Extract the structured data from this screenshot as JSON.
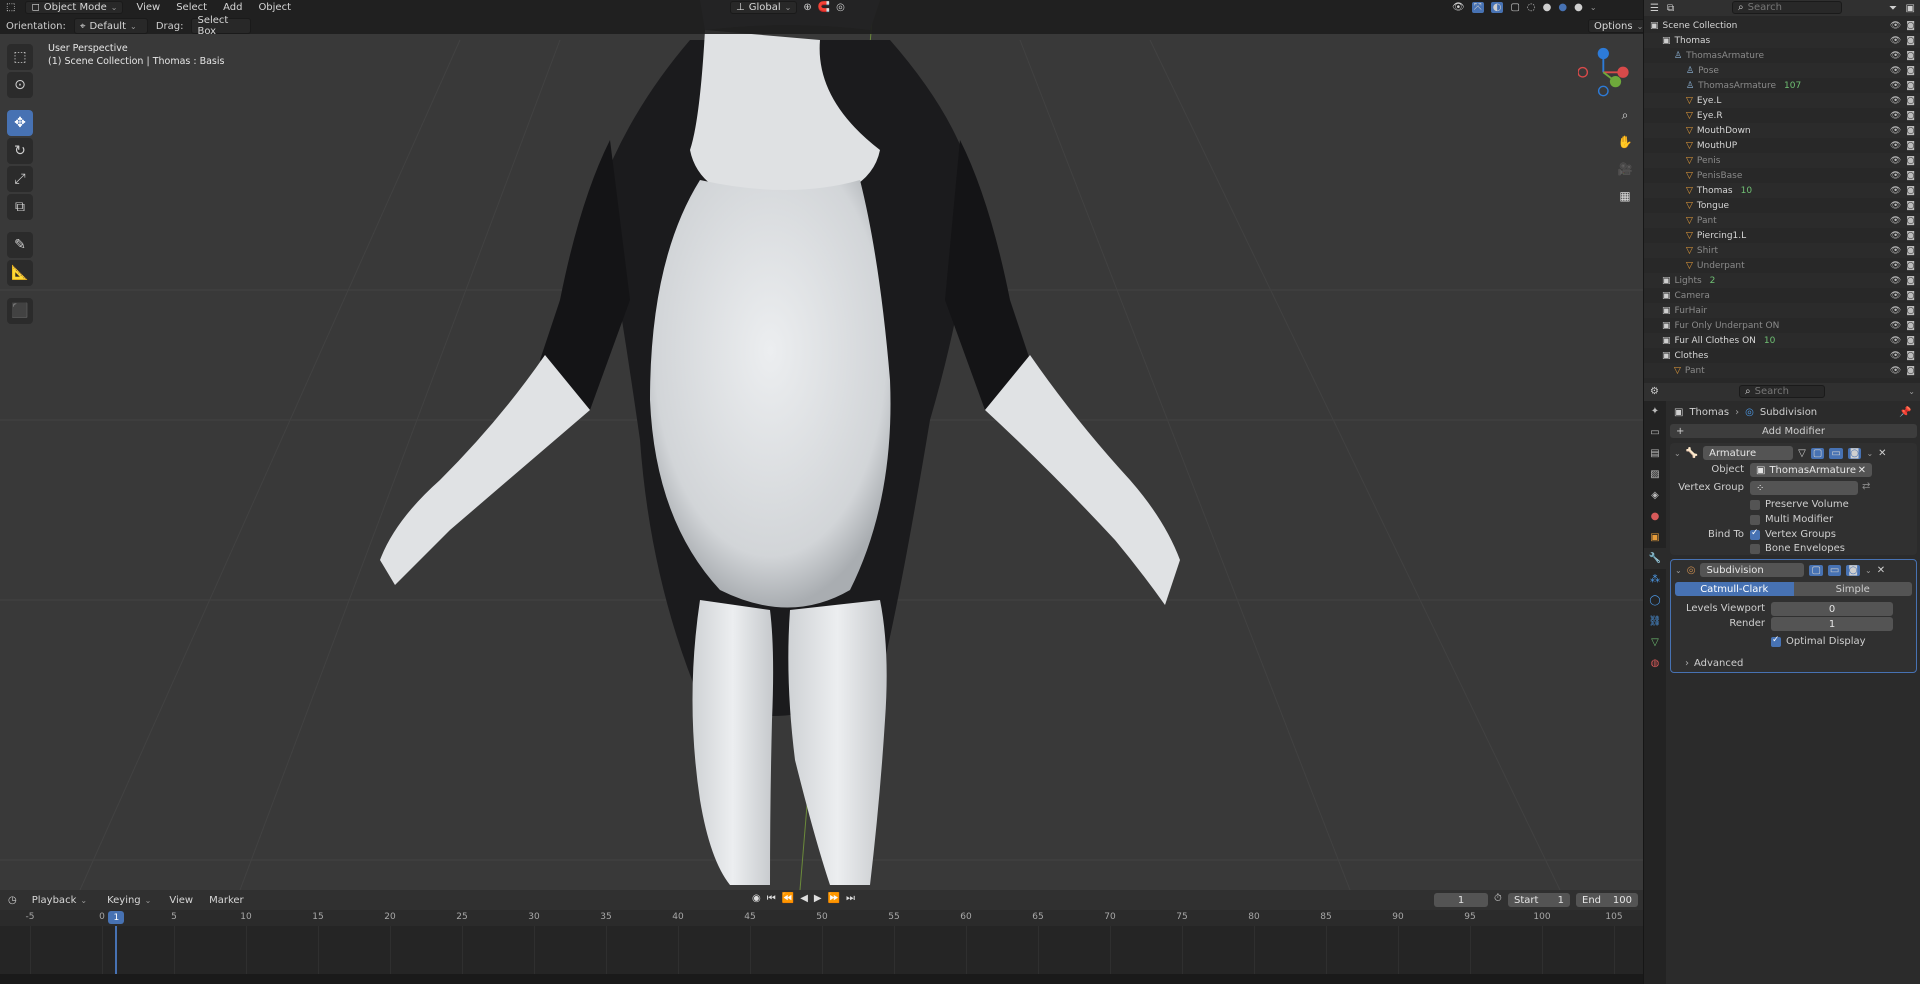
{
  "viewport": {
    "mode_label": "Object Mode",
    "menu": [
      "View",
      "Select",
      "Add",
      "Object"
    ],
    "orientation_label": "Orientation:",
    "orientation_value": "Default",
    "drag_label": "Drag:",
    "drag_value": "Select Box",
    "transform_orientation": "Global",
    "search_placeholder": "Search",
    "options_label": "Options",
    "info_line1": "User Perspective",
    "info_line2": "(1) Scene Collection | Thomas : Basis"
  },
  "timeline": {
    "menu": [
      "Playback",
      "Keying",
      "View",
      "Marker"
    ],
    "current_frame": "1",
    "start_label": "Start",
    "start_value": "1",
    "end_label": "End",
    "end_value": "100",
    "ticks": [
      "-5",
      "0",
      "5",
      "10",
      "15",
      "20",
      "25",
      "30",
      "35",
      "40",
      "45",
      "50",
      "55",
      "60",
      "65",
      "70",
      "75",
      "80",
      "85",
      "90",
      "95",
      "100",
      "105"
    ],
    "playhead": "1"
  },
  "outliner": {
    "search_placeholder": "Search",
    "rows": [
      {
        "name": "Scene Collection",
        "indent": 0,
        "icon": "▣",
        "dim": false
      },
      {
        "name": "Thomas",
        "indent": 1,
        "icon": "▣",
        "dim": false
      },
      {
        "name": "ThomasArmature",
        "indent": 2,
        "icon": "♙",
        "dim": true
      },
      {
        "name": "Pose",
        "indent": 3,
        "icon": "♙",
        "dim": true
      },
      {
        "name": "ThomasArmature",
        "indent": 3,
        "icon": "♙",
        "dim": true,
        "extra": "107"
      },
      {
        "name": "Eye.L",
        "indent": 3,
        "icon": "▽",
        "dim": false
      },
      {
        "name": "Eye.R",
        "indent": 3,
        "icon": "▽",
        "dim": false
      },
      {
        "name": "MouthDown",
        "indent": 3,
        "icon": "▽",
        "dim": false
      },
      {
        "name": "MouthUP",
        "indent": 3,
        "icon": "▽",
        "dim": false
      },
      {
        "name": "Penis",
        "indent": 3,
        "icon": "▽",
        "dim": true
      },
      {
        "name": "PenisBase",
        "indent": 3,
        "icon": "▽",
        "dim": true
      },
      {
        "name": "Thomas",
        "indent": 3,
        "icon": "▽",
        "dim": false,
        "extra": "10"
      },
      {
        "name": "Tongue",
        "indent": 3,
        "icon": "▽",
        "dim": false
      },
      {
        "name": "Pant",
        "indent": 3,
        "icon": "▽",
        "dim": true
      },
      {
        "name": "Piercing1.L",
        "indent": 3,
        "icon": "▽",
        "dim": false
      },
      {
        "name": "Shirt",
        "indent": 3,
        "icon": "▽",
        "dim": true
      },
      {
        "name": "Underpant",
        "indent": 3,
        "icon": "▽",
        "dim": true
      },
      {
        "name": "Lights",
        "indent": 1,
        "icon": "▣",
        "dim": true,
        "extra": "2"
      },
      {
        "name": "Camera",
        "indent": 1,
        "icon": "▣",
        "dim": true
      },
      {
        "name": "FurHair",
        "indent": 1,
        "icon": "▣",
        "dim": true
      },
      {
        "name": "Fur Only Underpant ON",
        "indent": 1,
        "icon": "▣",
        "dim": true
      },
      {
        "name": "Fur All Clothes ON",
        "indent": 1,
        "icon": "▣",
        "dim": false,
        "extra": "10"
      },
      {
        "name": "Clothes",
        "indent": 1,
        "icon": "▣",
        "dim": false
      },
      {
        "name": "Pant",
        "indent": 2,
        "icon": "▽",
        "dim": true
      }
    ]
  },
  "properties": {
    "search_placeholder": "Search",
    "breadcrumb_object": "Thomas",
    "breadcrumb_modifier": "Subdivision",
    "add_modifier": "Add Modifier",
    "armature": {
      "name": "Armature",
      "object_label": "Object",
      "object_value": "ThomasArmature",
      "vertex_group_label": "Vertex Group",
      "preserve_volume": "Preserve Volume",
      "multi_modifier": "Multi Modifier",
      "bind_to_label": "Bind To",
      "vertex_groups": "Vertex Groups",
      "bone_envelopes": "Bone Envelopes"
    },
    "subdivision": {
      "name": "Subdivision",
      "catmull": "Catmull-Clark",
      "simple": "Simple",
      "levels_viewport_label": "Levels Viewport",
      "levels_viewport_value": "0",
      "render_label": "Render",
      "render_value": "1",
      "optimal_display": "Optimal Display",
      "advanced": "Advanced"
    }
  },
  "colors": {
    "accent": "#4772b3",
    "viewport_bg": "#393939",
    "fur_dark": "#1b1b1d",
    "fur_light": "#e4e6e8"
  }
}
